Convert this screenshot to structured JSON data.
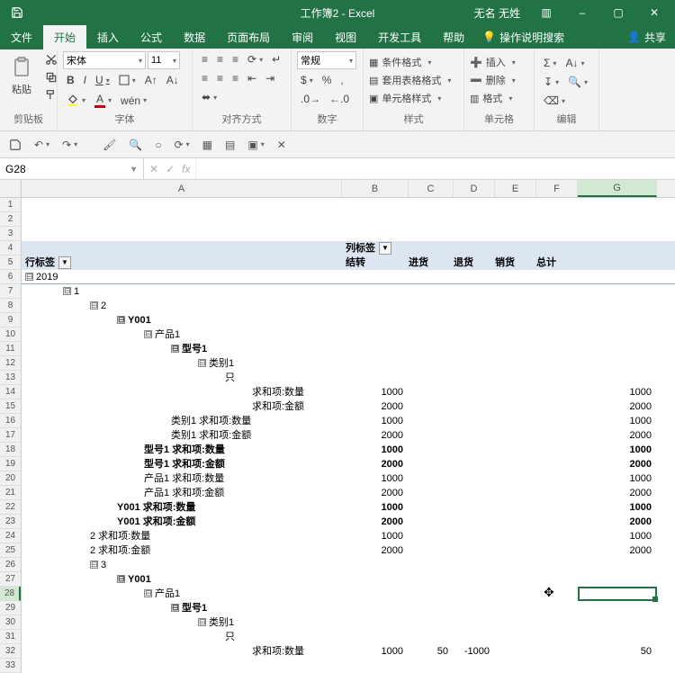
{
  "titlebar": {
    "title": "工作簿2 - Excel",
    "user": "无名 无姓",
    "minimize": "–",
    "restore": "▢",
    "close": "✕",
    "ribbon_options": "▥"
  },
  "tabs": {
    "file": "文件",
    "home": "开始",
    "insert": "插入",
    "formulas": "公式",
    "data": "数据",
    "page_layout": "页面布局",
    "review": "审阅",
    "view": "视图",
    "developer": "开发工具",
    "help": "帮助",
    "tell_me": "操作说明搜索",
    "share": "共享"
  },
  "ribbon": {
    "clipboard": {
      "paste": "粘贴",
      "label": "剪贴板"
    },
    "font": {
      "name": "宋体",
      "size": "11",
      "label": "字体",
      "bold": "B",
      "italic": "I",
      "underline": "U"
    },
    "alignment": {
      "label": "对齐方式"
    },
    "number": {
      "format": "常规",
      "label": "数字"
    },
    "styles": {
      "cond_fmt": "条件格式",
      "table_fmt": "套用表格格式",
      "cell_styles": "单元格样式",
      "label": "样式"
    },
    "cells": {
      "insert": "插入",
      "delete": "删除",
      "format": "格式",
      "label": "单元格"
    },
    "editing": {
      "label": "编辑"
    }
  },
  "formula_bar": {
    "name_box": "G28",
    "fx": "fx"
  },
  "columns": {
    "A": "A",
    "B": "B",
    "C": "C",
    "D": "D",
    "E": "E",
    "F": "F",
    "G": "G"
  },
  "col_widths": {
    "A": 356,
    "B": 74,
    "C": 50,
    "D": 46,
    "E": 46,
    "F": 46,
    "G": 88
  },
  "pivot": {
    "col_labels_header": "列标签",
    "row_labels_header": "行标签",
    "col_headers": [
      "结转",
      "进货",
      "退货",
      "销货",
      "总计"
    ],
    "collapse": "⊟"
  },
  "rows": {
    "r6": {
      "indent": 0,
      "btn": true,
      "text": "2019",
      "underline": true
    },
    "r7": {
      "indent": 1,
      "btn": true,
      "text": "1"
    },
    "r8": {
      "indent": 2,
      "btn": true,
      "text": "2"
    },
    "r9": {
      "indent": 3,
      "btn": true,
      "text": "Y001",
      "bold": true
    },
    "r10": {
      "indent": 4,
      "btn": true,
      "text": "产品1"
    },
    "r11": {
      "indent": 5,
      "btn": true,
      "text": "型号1",
      "bold": true
    },
    "r12": {
      "indent": 6,
      "btn": true,
      "text": "类别1"
    },
    "r13": {
      "indent": 7,
      "text": "只"
    },
    "r14": {
      "indent": 8,
      "text": "求和项:数量",
      "b": "1000",
      "g": "1000"
    },
    "r15": {
      "indent": 8,
      "text": "求和项:金额",
      "b": "2000",
      "g": "2000"
    },
    "r16": {
      "indent": 5,
      "text": "类别1 求和项:数量",
      "b": "1000",
      "g": "1000"
    },
    "r17": {
      "indent": 5,
      "text": "类别1 求和项:金额",
      "b": "2000",
      "g": "2000"
    },
    "r18": {
      "indent": 4,
      "text": "型号1 求和项:数量",
      "bold": true,
      "b": "1000",
      "g": "1000"
    },
    "r19": {
      "indent": 4,
      "text": "型号1 求和项:金额",
      "bold": true,
      "b": "2000",
      "g": "2000"
    },
    "r20": {
      "indent": 4,
      "text": "产品1 求和项:数量",
      "b": "1000",
      "g": "1000"
    },
    "r21": {
      "indent": 4,
      "text": "产品1 求和项:金额",
      "b": "2000",
      "g": "2000"
    },
    "r22": {
      "indent": 3,
      "text": "Y001 求和项:数量",
      "bold": true,
      "b": "1000",
      "g": "1000"
    },
    "r23": {
      "indent": 3,
      "text": "Y001 求和项:金额",
      "bold": true,
      "b": "2000",
      "g": "2000"
    },
    "r24": {
      "indent": 2,
      "text": "2 求和项:数量",
      "b": "1000",
      "g": "1000"
    },
    "r25": {
      "indent": 2,
      "text": "2 求和项:金额",
      "b": "2000",
      "g": "2000"
    },
    "r26": {
      "indent": 2,
      "btn": true,
      "text": "3"
    },
    "r27": {
      "indent": 3,
      "btn": true,
      "text": "Y001",
      "bold": true
    },
    "r28": {
      "indent": 4,
      "btn": true,
      "text": "产品1"
    },
    "r29": {
      "indent": 5,
      "btn": true,
      "text": "型号1",
      "bold": true
    },
    "r30": {
      "indent": 6,
      "btn": true,
      "text": "类别1"
    },
    "r31": {
      "indent": 7,
      "text": "只"
    },
    "r32": {
      "indent": 8,
      "text": "求和项:数量",
      "b": "1000",
      "c": "50",
      "d": "-1000",
      "g": "50"
    }
  },
  "cursor": {
    "glyph": "✥"
  }
}
